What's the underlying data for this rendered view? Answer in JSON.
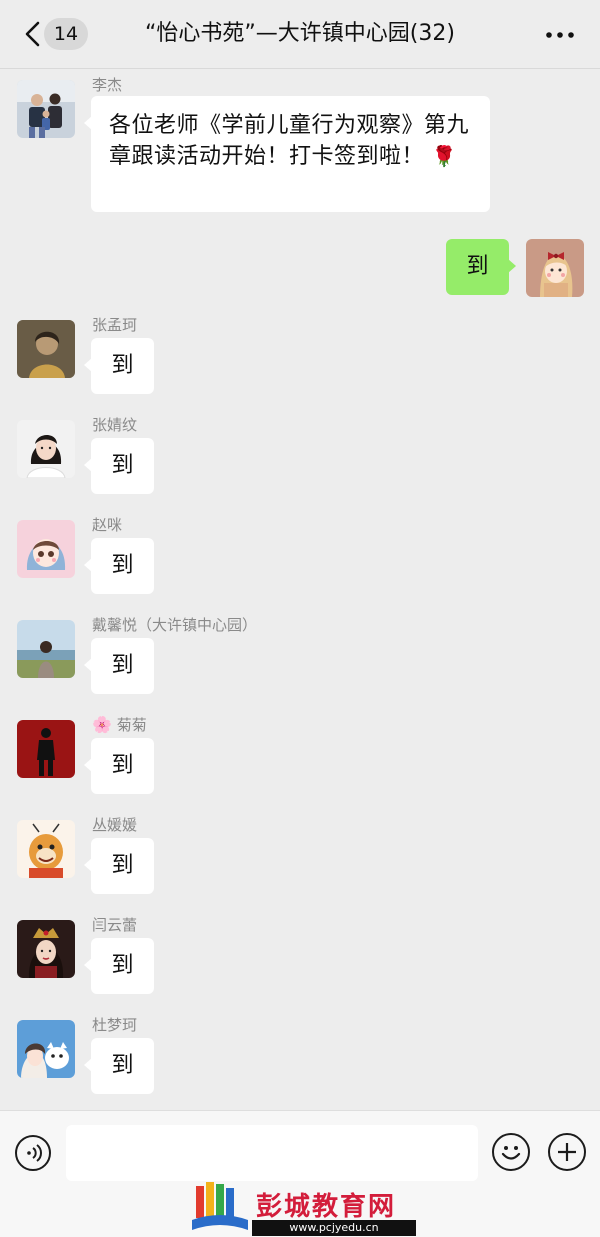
{
  "header": {
    "unread_count": "14",
    "title": "“怡心书苑”—大许镇中心园(32)",
    "back_icon": "chevron-left-icon",
    "more_icon": "more-horizontal-icon"
  },
  "messages": [
    {
      "sender": "李杰",
      "text": "各位老师《学前儿童行为观察》第九章跟读活动开始！打卡签到啦！",
      "emoji": "🌹"
    },
    {
      "sender": "",
      "text": "到",
      "mine": true
    },
    {
      "sender": "张孟珂",
      "text": "到"
    },
    {
      "sender": "张婧纹",
      "text": "到"
    },
    {
      "sender": "赵咪",
      "text": "到"
    },
    {
      "sender": "戴馨悦（大许镇中心园）",
      "text": "到"
    },
    {
      "sender": "菊菊",
      "sender_emoji": "🌸",
      "text": "到"
    },
    {
      "sender": "丛媛媛",
      "text": "到"
    },
    {
      "sender": "闫云蕾",
      "text": "到"
    },
    {
      "sender": "杜梦珂",
      "text": "到"
    }
  ],
  "input_bar": {
    "voice_icon": "voice-icon",
    "emoji_icon": "emoji-icon",
    "add_icon": "plus-circle-icon",
    "value": "",
    "placeholder": ""
  },
  "watermark": {
    "text": "彭城教育网",
    "url": "www.pcjyedu.cn"
  },
  "colors": {
    "background": "#ededed",
    "bubble_mine": "#95ec69",
    "bubble_other": "#ffffff"
  }
}
